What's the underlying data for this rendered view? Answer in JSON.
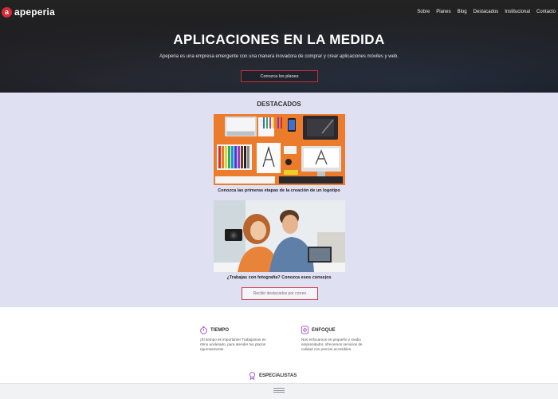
{
  "brand": {
    "name": "apeperia",
    "logo_letter": "a"
  },
  "nav": {
    "items": [
      {
        "label": "Sobre"
      },
      {
        "label": "Planes"
      },
      {
        "label": "Blog"
      },
      {
        "label": "Destacados"
      },
      {
        "label": "Institucional"
      },
      {
        "label": "Contacto"
      }
    ]
  },
  "hero": {
    "title": "APLICACIONES EN LA MEDIDA",
    "subtitle": "Apeperia es una empresa emergente con una manera inovadora de comprar y crear aplicaciones móviles y web.",
    "button_label": "Conozca los planes"
  },
  "featured": {
    "heading": "DESTACADOS",
    "cards": [
      {
        "caption": "Conozca las primeras etapas de la creación de un logotipo"
      },
      {
        "caption": "¿Trabajas con fotografía? Conozca esos consejos"
      }
    ],
    "more_button_label": "Recibir destacados por correo"
  },
  "features": {
    "tiempo": {
      "title": "TIEMPO",
      "text": "¡El tiempo es importante! Trabajamos en ritmo acelerado, para atender tus plazos rigurosamente."
    },
    "enfoque": {
      "title": "ENFOQUE",
      "text": "Nos enfocamos en pequeño y medio emprendedor, ofrecemos servicios de calidad con precios accesibles."
    },
    "especialistas": {
      "title": "ESPECIALISTAS"
    }
  },
  "colors": {
    "accent": "#c0303b",
    "featured_bg": "#dfe0f2",
    "icon_purple": "#9b4fd1",
    "hero_bg": "#1c1c20"
  },
  "icons": {
    "tiempo": "stopwatch-icon",
    "enfoque": "target-icon",
    "especialistas": "award-medal-icon",
    "scroll": "drag-handle-icon"
  }
}
